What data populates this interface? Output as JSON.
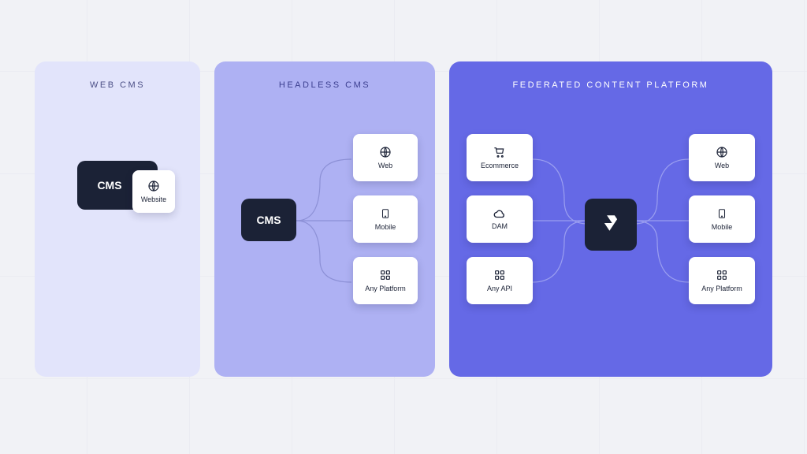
{
  "panel1": {
    "title": "WEB CMS",
    "cms": "CMS",
    "website": "Website"
  },
  "panel2": {
    "title": "HEADLESS CMS",
    "cms": "CMS",
    "outputs": [
      "Web",
      "Mobile",
      "Any Platform"
    ]
  },
  "panel3": {
    "title": "FEDERATED CONTENT PLATFORM",
    "inputs": [
      "Ecommerce",
      "DAM",
      "Any API"
    ],
    "outputs": [
      "Web",
      "Mobile",
      "Any Platform"
    ]
  }
}
